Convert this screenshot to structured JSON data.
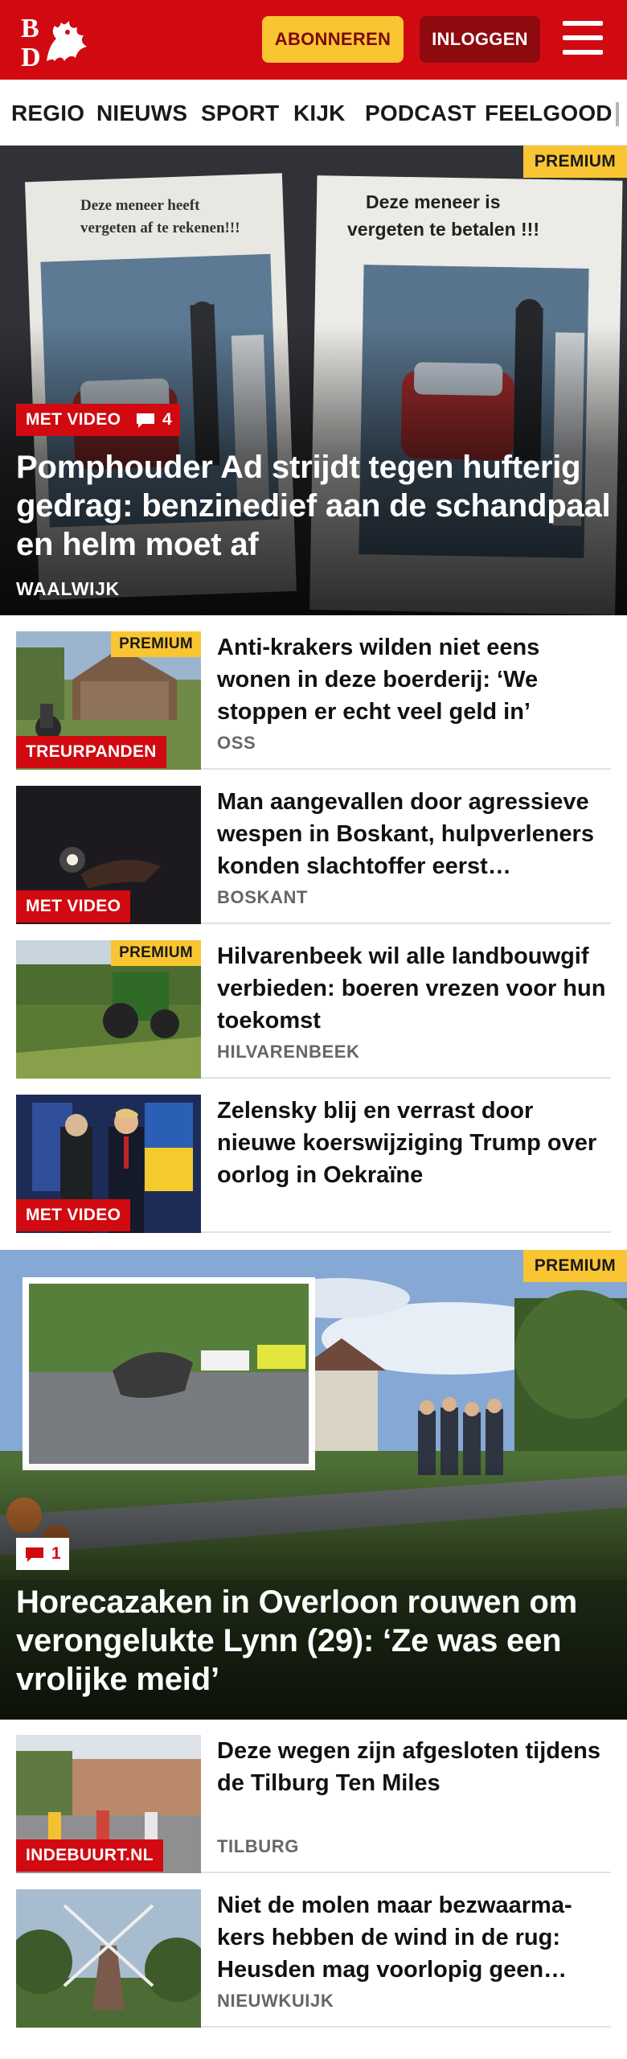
{
  "header": {
    "logo_text": "BD",
    "subscribe_label": "ABONNEREN",
    "login_label": "INLOGGEN",
    "brand_color": "#d10a11",
    "accent_color": "#f9c532"
  },
  "nav": {
    "items": [
      "REGIO",
      "NIEUWS",
      "SPORT",
      "KIJK",
      "PODCAST",
      "FEELGOOD"
    ]
  },
  "hero1": {
    "premium": "PREMIUM",
    "video_label": "MET VIDEO",
    "comments": "4",
    "title": "Pomphouder Ad strijdt tegen hufterig gedrag: benzinedief aan de schandpaal en helm moet af",
    "location": "WAALWIJK",
    "photo_text_left": "Deze meneer heeft vergeten af te rekenen!!!",
    "photo_text_right": "Deze meneer is vergeten te betalen !!!"
  },
  "items_a": [
    {
      "title": "Anti-krakers wilden niet eens wonen in deze boerderij: ‘We stoppen er echt veel geld in’",
      "location": "OSS",
      "tag": "TREURPANDEN",
      "premium": "PREMIUM"
    },
    {
      "title": "Man aangevallen door agressieve wespen in Boskant, hulpverle­ners konden slachtoffer eerst…",
      "location": "BOSKANT",
      "tag": "MET VIDEO",
      "premium": ""
    },
    {
      "title": "Hilvarenbeek wil alle landbouw­gif verbieden: boeren vrezen voor hun toekomst",
      "location": "HILVARENBEEK",
      "tag": "",
      "premium": "PREMIUM"
    },
    {
      "title": "Zelensky blij en verrast door nieuwe koerswijziging Trump over oorlog in Oekraïne",
      "location": "",
      "tag": "MET VIDEO",
      "premium": ""
    }
  ],
  "hero2": {
    "premium": "PREMIUM",
    "comments": "1",
    "title": "Horecazaken in Overloon rouwen om verongelukte Lynn (29): ‘Ze was een vrolijke meid’"
  },
  "items_b": [
    {
      "title": "Deze wegen zijn afgesloten tijdens de Tilburg Ten Miles",
      "location": "TILBURG",
      "tag": "INDEBUURT.NL"
    },
    {
      "title": "Niet de molen maar bezwaarma­kers hebben de wind in de rug: Heusden mag voorlopig geen…",
      "location": "NIEUWKUIJK",
      "tag": ""
    }
  ]
}
